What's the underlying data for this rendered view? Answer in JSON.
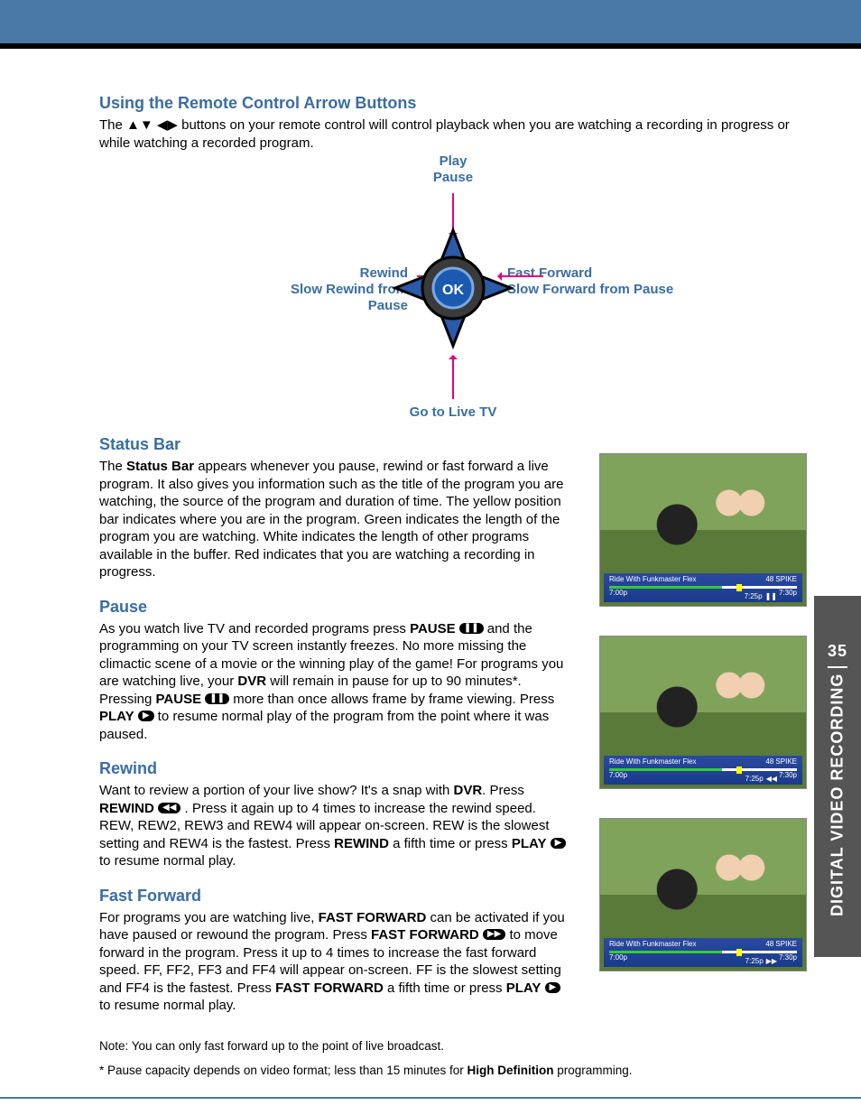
{
  "sideTab": {
    "pageNum": "35",
    "label": "DIGITAL VIDEO RECORDING"
  },
  "section1": {
    "heading": "Using the Remote Control Arrow Buttons",
    "intro_a": "The ",
    "intro_b": " buttons on your remote control will control playback when you are watching a recording in progress or while watching a recorded program."
  },
  "diagram": {
    "top1": "Play",
    "top2": "Pause",
    "left1": "Rewind",
    "left2": "Slow Rewind from",
    "left3": "Pause",
    "right1": "Fast Forward",
    "right2": "Slow Forward from Pause",
    "bottom": "Go to Live TV",
    "ok": "OK"
  },
  "statusBar": {
    "heading": "Status Bar",
    "p_a": "The ",
    "p_bold": "Status Bar",
    "p_b": " appears whenever you pause, rewind or fast forward a live program. It also gives you information such as the title of the program you are watching, the source of the program and duration of time. The yellow position bar indicates where you are in the program. Green indicates the length of the program you are watching. White indicates the length of other programs available in the buffer. Red indicates that you are watching a recording in progress."
  },
  "pause": {
    "heading": "Pause",
    "p": "As you watch live TV and recorded programs press PAUSE ⏸ and the programming on your TV screen instantly freezes. No more missing the climactic scene of a movie or the winning play of the game!  For programs you are watching live, your DVR will remain in pause for up to 90 minutes*.  Pressing PAUSE ⏸ more than once allows frame by frame viewing. Press PLAY ▶ to resume normal play of the program from the point where it was paused."
  },
  "rewind": {
    "heading": "Rewind",
    "p": "Want to review a portion of your live show?  It's a snap with DVR. Press REWIND ⏪ . Press it again up to 4 times to increase the rewind speed. REW, REW2, REW3 and REW4 will appear on-screen. REW is the slowest setting and REW4 is the fastest.  Press REWIND a fifth time or press PLAY ▶ to resume normal play."
  },
  "ff": {
    "heading": "Fast Forward",
    "p": "For programs you are watching live, FAST FORWARD can be activated if you have paused or rewound the program. Press FAST FORWARD ⏩ to move forward in the program. Press it up to 4 times to increase the fast forward speed. FF, FF2, FF3 and FF4 will appear on-screen. FF is the slowest setting and FF4 is the fastest. Press FAST FORWARD a fifth time or press PLAY ▶ to resume normal play."
  },
  "notes": {
    "n1": "Note: You can only fast forward up to the point of live broadcast.",
    "n2_a": "* Pause capacity depends on video format; less than 15 minutes for ",
    "n2_bold": "High Definition",
    "n2_b": " programming."
  },
  "screenshot": {
    "title": "Ride With Funkmaster Flex",
    "channel": "48 SPIKE",
    "start": "7:00p",
    "end": "7:30p",
    "pos": "7:25p",
    "ind1": "❚❚",
    "ind2": "◀◀",
    "ind3": "▶▶"
  }
}
